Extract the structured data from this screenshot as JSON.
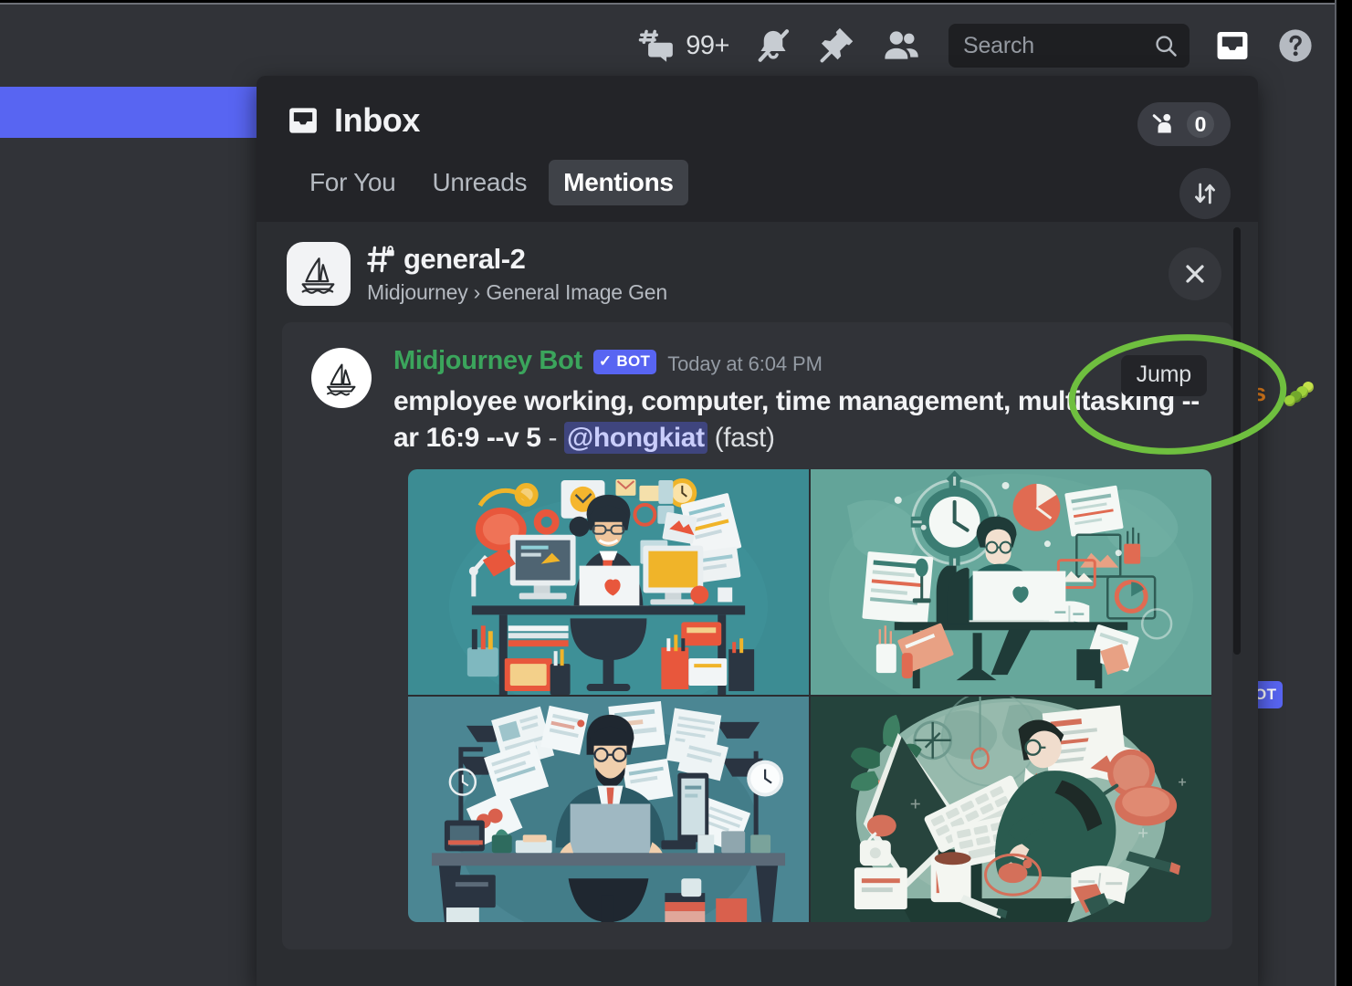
{
  "topbar": {
    "threads_icon": "threads-icon",
    "threads_count": "99+",
    "mute_icon": "bell-muted-icon",
    "pin_icon": "pin-icon",
    "members_icon": "members-icon",
    "search_placeholder": "Search",
    "search_icon": "search-icon",
    "inbox_icon": "inbox-icon",
    "help_icon": "help-icon"
  },
  "inbox": {
    "title": "Inbox",
    "title_icon": "inbox-icon",
    "tabs": [
      {
        "label": "For You",
        "active": false
      },
      {
        "label": "Unreads",
        "active": false
      },
      {
        "label": "Mentions",
        "active": true
      }
    ],
    "hand_raise": {
      "icon": "raise-hand-icon",
      "count": "0"
    },
    "sort_icon": "sort-icon",
    "close_icon": "close-icon"
  },
  "channel": {
    "guild_icon": "midjourney-sailboat-icon",
    "hash_icon": "hash-locked-icon",
    "name": "general-2",
    "breadcrumb": "Midjourney › General Image Gen"
  },
  "message": {
    "avatar_icon": "midjourney-sailboat-avatar",
    "author": "Midjourney Bot",
    "bot_tag": "BOT",
    "bot_tag_check": "✓",
    "timestamp": "Today at 6:04 PM",
    "text_bold_1": "employee working, computer, time management, multitasking --ar 16:9 --v 5",
    "text_dash": "-",
    "mention": "@hongkiat",
    "text_suffix": "(fast)",
    "jump_label": "Jump",
    "images": [
      {
        "alt": "businessman-at-desk-teal-flat-illustration"
      },
      {
        "alt": "man-at-imac-with-clock-gear-green-illustration"
      },
      {
        "alt": "bearded-man-laptop-flying-papers-illustration"
      },
      {
        "alt": "overhead-desk-keyboard-plant-green-illustration"
      }
    ]
  },
  "background": {
    "orange_text_fragment": "s",
    "caterpillar_emoji": "caterpillar-emoji",
    "bot_badge_fragment": "OT"
  },
  "annotation": {
    "shape": "green-ellipse-highlight",
    "color": "#6fbf3f",
    "target": "jump-button"
  },
  "colors": {
    "blurple": "#5865f2",
    "panel_bg": "#2b2d31",
    "panel_header_bg": "#232428",
    "card_bg": "#313338",
    "bot_green": "#3ba55c",
    "annotation_green": "#6fbf3f"
  }
}
